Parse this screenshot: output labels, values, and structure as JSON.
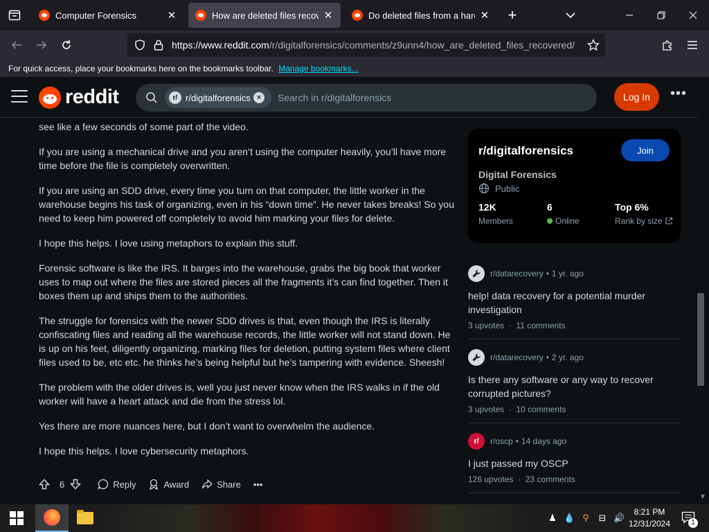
{
  "browser": {
    "tabs": [
      {
        "title": "Computer Forensics",
        "active": false
      },
      {
        "title": "How are deleted files recovered",
        "active": true
      },
      {
        "title": "Do deleted files from a hard dri",
        "active": false
      }
    ],
    "url": {
      "base": "https://www.reddit.com",
      "path": "/r/digitalforensics/comments/z9unn4/how_are_deleted_files_recovered/"
    },
    "bookmarks_bar": {
      "message": "For quick access, place your bookmarks here on the bookmarks toolbar.",
      "link": "Manage bookmarks..."
    }
  },
  "header": {
    "logo_text": "reddit",
    "search_chip": "r/digitalforensics",
    "search_chip_icon": "r/",
    "search_placeholder": "Search in r/digitalforensics",
    "login_label": "Log In",
    "more_label": "•••"
  },
  "post": {
    "paragraphs": [
      "see like a few seconds of some part of the video.",
      "If you are using a mechanical drive and you aren’t using the computer heavily, you’ll have more time before the file is completely overwritten.",
      "If you are using an SDD drive, every time you turn on that computer, the little worker in the warehouse begins his task of organizing, even in his “down time”. He never takes breaks! So you need to keep him powered off completely to avoid him marking your files for delete.",
      "I hope this helps. I love using metaphors to explain this stuff.",
      "Forensic software is like the IRS. It barges into the warehouse, grabs the big book that worker uses to map out where the files are stored pieces all the fragments it’s can find together. Then it boxes them up and ships them to the authorities.",
      "The struggle for forensics with the newer SDD drives is that, even though the IRS is literally confiscating files and reading all the warehouse records, the little worker will not stand down. He is up on his feet, diligently organizing, marking files for deletion, putting system files where client files used to be, etc etc. he thinks he’s being helpful but he’s tampering with evidence. Sheesh!",
      "The problem with the older drives is, well you just never know when the IRS walks in if the old worker will have a heart attack and die from the stress lol.",
      "Yes there are more nuances here, but I don’t want to overwhelm the audience.",
      "I hope this helps. I love cybersecurity metaphors."
    ],
    "actions": {
      "vote_count": "6",
      "reply": "Reply",
      "award": "Award",
      "share": "Share",
      "more": "•••"
    }
  },
  "sidebar": {
    "community": {
      "name": "r/digitalforensics",
      "join_label": "Join",
      "title": "Digital Forensics",
      "visibility": "Public",
      "stats": [
        {
          "value": "12K",
          "label": "Members"
        },
        {
          "value": "6",
          "label": "Online"
        },
        {
          "value": "Top 6%",
          "label": "Rank by size"
        }
      ]
    },
    "related": [
      {
        "icon": "wrench-icon",
        "subreddit": "r/datarecovery",
        "age": "1 yr. ago",
        "title": "help! data recovery for a potential murder investigation",
        "upvotes": "3 upvotes",
        "comments": "11 comments"
      },
      {
        "icon": "wrench-icon",
        "subreddit": "r/datarecovery",
        "age": "2 yr. ago",
        "title": "Is there any software or any way to recover corrupted pictures?",
        "upvotes": "3 upvotes",
        "comments": "10 comments"
      },
      {
        "icon": "subreddit-icon",
        "subreddit": "r/oscp",
        "age": "14 days ago",
        "title": "I just passed my OSCP",
        "upvotes": "126 upvotes",
        "comments": "23 comments"
      }
    ]
  },
  "taskbar": {
    "time": "8:21 PM",
    "date": "12/31/2024",
    "notification_count": "1"
  }
}
